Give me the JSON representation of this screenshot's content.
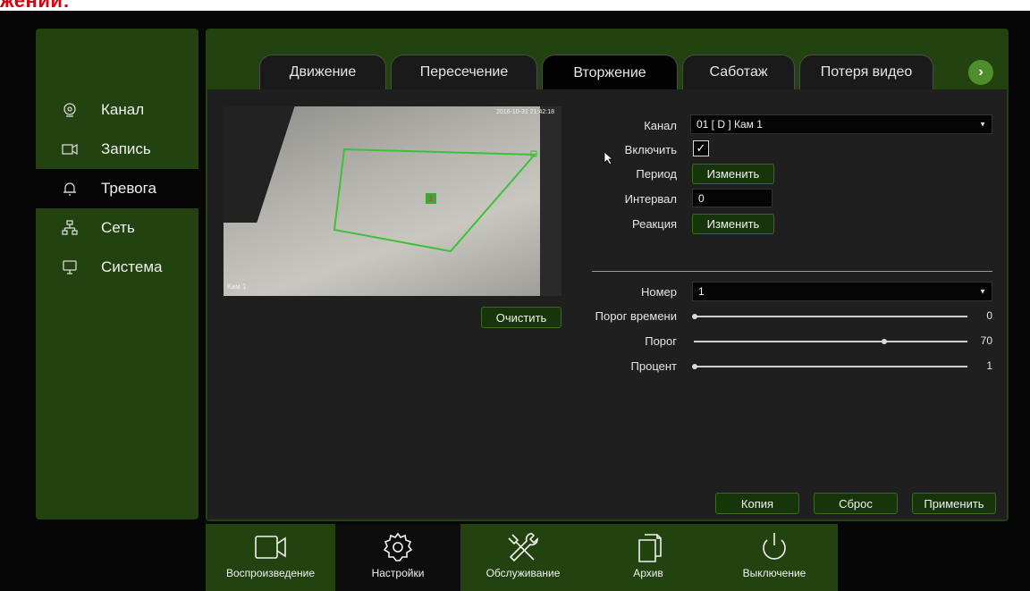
{
  "top_title": "жений:",
  "sidebar": {
    "items": [
      {
        "label": "Канал",
        "icon": "camera-icon"
      },
      {
        "label": "Запись",
        "icon": "record-icon"
      },
      {
        "label": "Тревога",
        "icon": "bell-icon",
        "active": true
      },
      {
        "label": "Сеть",
        "icon": "network-icon"
      },
      {
        "label": "Система",
        "icon": "monitor-icon"
      }
    ]
  },
  "tabs": [
    {
      "label": "Движение"
    },
    {
      "label": "Пересечение"
    },
    {
      "label": "Вторжение",
      "active": true
    },
    {
      "label": "Саботаж"
    },
    {
      "label": "Потеря видео"
    }
  ],
  "tab_next_icon": "chevron-right-icon",
  "preview": {
    "timestamp": "2016-10-31 21:42:18",
    "cam_name": "Кам 1",
    "zone_marker": "1",
    "clear_button": "Очистить"
  },
  "form": {
    "channel_label": "Канал",
    "channel_value": "01 [ D ] Кам 1",
    "enable_label": "Включить",
    "enable_checked": true,
    "period_label": "Период",
    "period_button": "Изменить",
    "interval_label": "Интервал",
    "interval_value": "0",
    "reaction_label": "Реакция",
    "reaction_button": "Изменить",
    "number_label": "Номер",
    "number_value": "1",
    "time_threshold_label": "Порог времени",
    "time_threshold_value": "0",
    "threshold_label": "Порог",
    "threshold_value": "70",
    "percent_label": "Процент",
    "percent_value": "1"
  },
  "actions": {
    "copy": "Копия",
    "reset": "Сброс",
    "apply": "Применить"
  },
  "bottombar": {
    "items": [
      {
        "label": "Воспроизведение",
        "icon": "video-camera-icon"
      },
      {
        "label": "Настройки",
        "icon": "gear-icon",
        "active": true
      },
      {
        "label": "Обслуживание",
        "icon": "tools-icon"
      },
      {
        "label": "Архив",
        "icon": "files-icon"
      },
      {
        "label": "Выключение",
        "icon": "power-icon"
      }
    ]
  },
  "colors": {
    "panel_green": "#22420f",
    "button_green": "#17350b",
    "accent_green": "#4f8d2d",
    "zone_line": "#3ec13a",
    "title_red": "#d9000d"
  }
}
